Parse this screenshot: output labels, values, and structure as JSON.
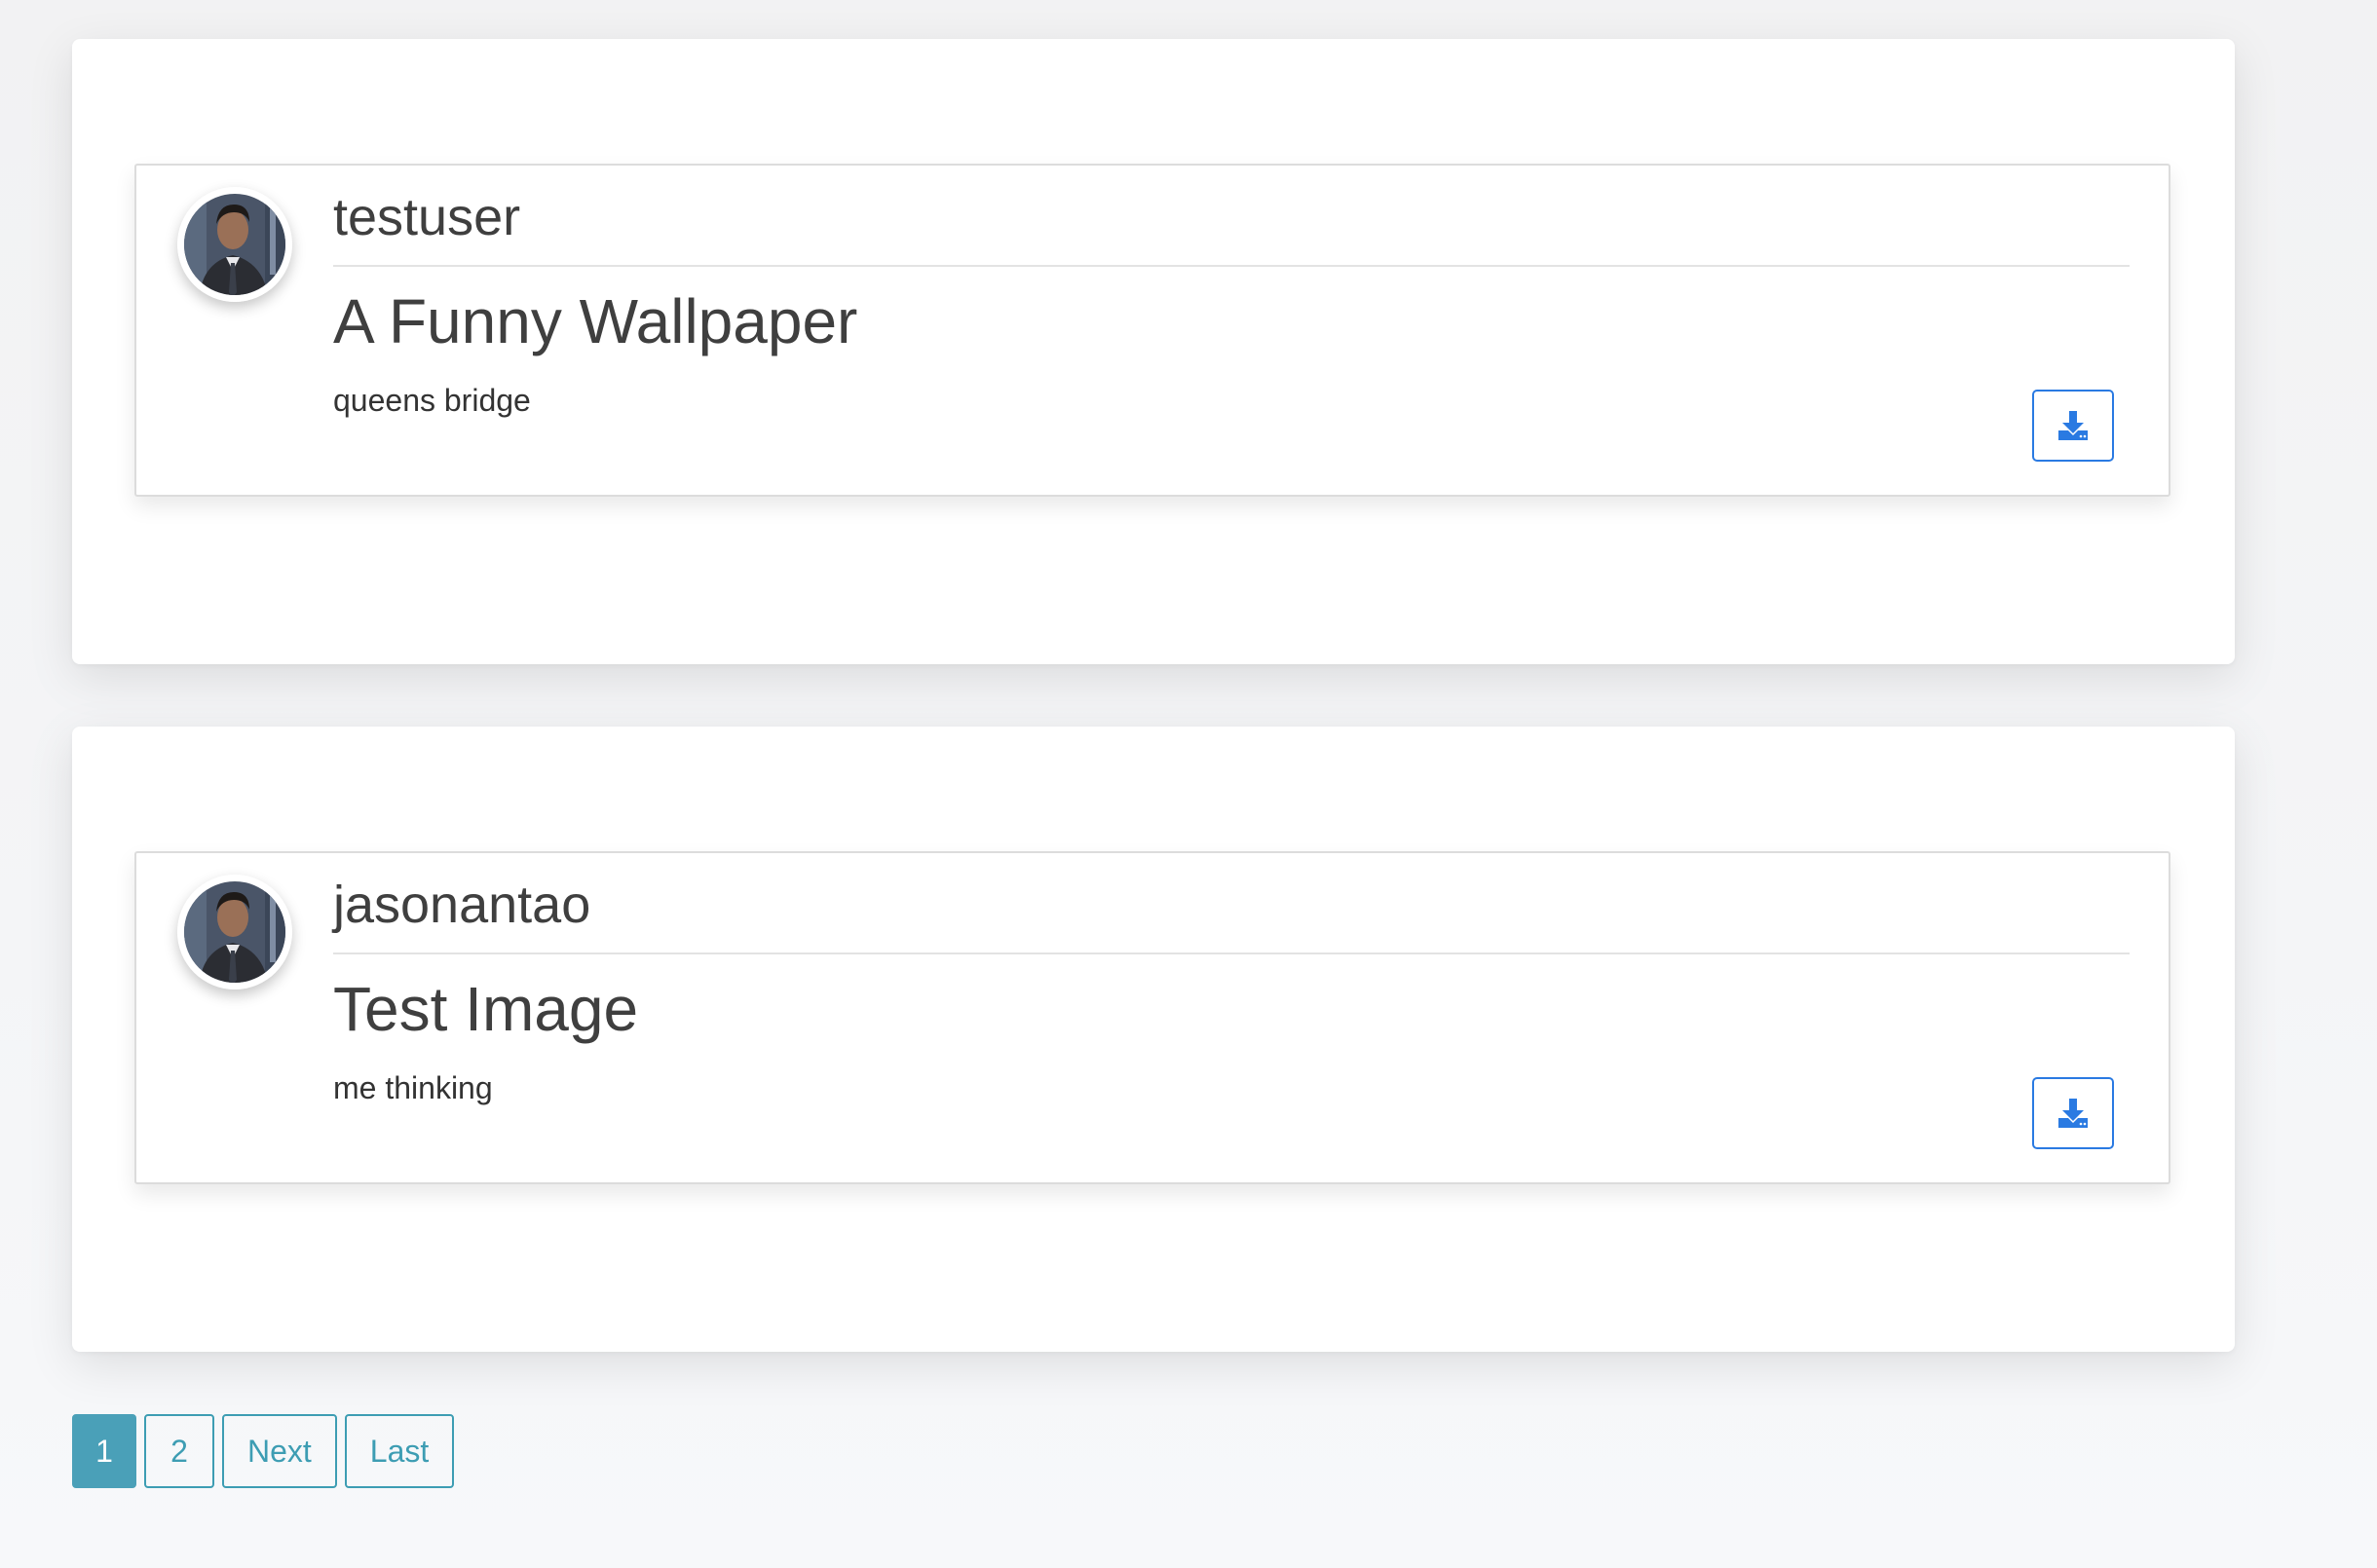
{
  "colors": {
    "accent_blue": "#2a7ae2",
    "pagination_teal": "#4aa0b8"
  },
  "posts": [
    {
      "username": "testuser",
      "title": "A Funny Wallpaper",
      "caption": "queens bridge",
      "avatar_icon": "user-avatar",
      "action_icon": "download-icon"
    },
    {
      "username": "jasonantao",
      "title": "Test Image",
      "caption": "me thinking",
      "avatar_icon": "user-avatar",
      "action_icon": "download-icon"
    }
  ],
  "pagination": {
    "current": "1",
    "page2": "2",
    "next": "Next",
    "last": "Last"
  }
}
